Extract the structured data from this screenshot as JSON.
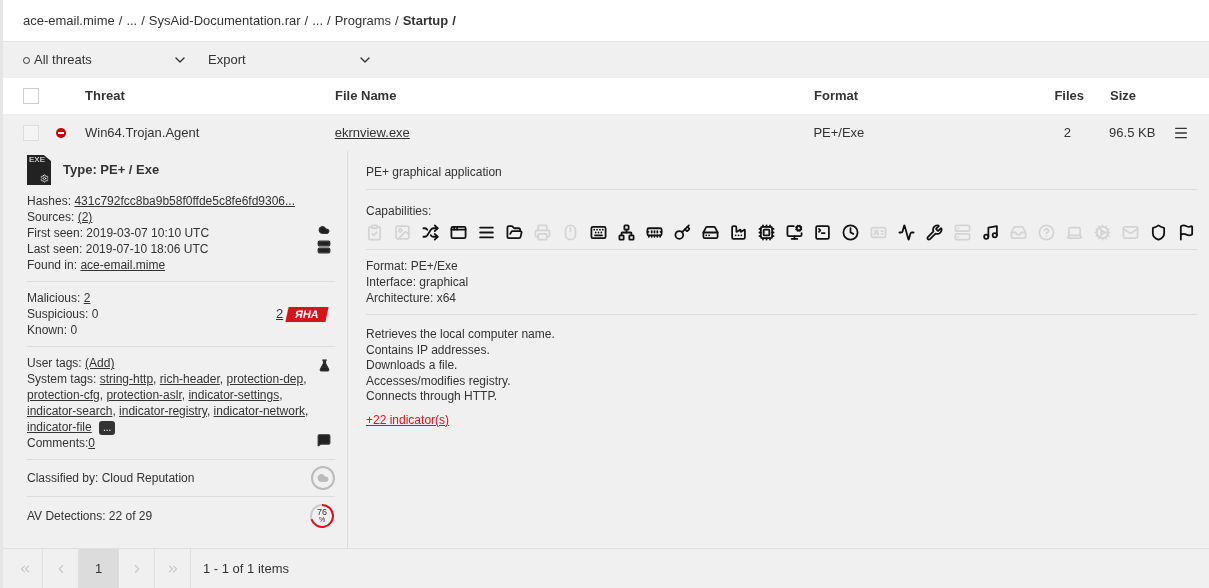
{
  "breadcrumb": {
    "separator": "/",
    "items": [
      {
        "label": "ace-email.mime",
        "current": false
      },
      {
        "label": "...",
        "current": false
      },
      {
        "label": "SysAid-Documentation.rar",
        "current": false
      },
      {
        "label": "...",
        "current": false
      },
      {
        "label": "Programs",
        "current": false
      },
      {
        "label": "Startup",
        "current": true
      }
    ]
  },
  "toolbar": {
    "filter": "All threats",
    "export": "Export"
  },
  "table": {
    "header_checked": false,
    "columns": [
      "Threat",
      "File Name",
      "Format",
      "Files",
      "Size"
    ],
    "rows": [
      {
        "checked": false,
        "expanded": true,
        "threat": "Win64.Trojan.Agent",
        "file_name": "ekrnview.exe",
        "format": "PE+/Exe",
        "files": "2",
        "size": "96.5 KB"
      }
    ]
  },
  "details": {
    "file_badge": "EXE",
    "type": "Type: PE+ / Exe",
    "info": [
      {
        "label": "Hashes:",
        "value": "431c792fcc8ba9b58f0ffde5c8fe6fd9306...",
        "link": true
      },
      {
        "label": "Sources:",
        "value": "(2)",
        "link": true
      },
      {
        "label": "First seen:",
        "value": "2019-03-07 10:10 UTC",
        "link": false
      },
      {
        "label": "Last seen:",
        "value": "2019-07-10 18:06 UTC",
        "link": false
      },
      {
        "label": "Found in:",
        "value": "ace-email.mime",
        "link": true
      }
    ],
    "counts": [
      {
        "label": "Malicious:",
        "value": "2",
        "link": true
      },
      {
        "label": "Suspicious:",
        "value": "0",
        "link": false
      },
      {
        "label": "Known:",
        "value": "0",
        "link": false
      }
    ],
    "rha": {
      "count": "2",
      "badge": "ЯHA"
    },
    "user_tags": {
      "label": "User tags:",
      "value": "(Add)"
    },
    "system_tags": {
      "label": "System tags:",
      "tags": [
        "string-http",
        "rich-header",
        "protection-dep",
        "protection-cfg",
        "protection-aslr",
        "indicator-settings",
        "indicator-search",
        "indicator-registry",
        "indicator-network",
        "indicator-file"
      ],
      "separator": ",",
      "more": "..."
    },
    "comments": {
      "label": "Comments:",
      "value": "0"
    },
    "classified": "Classified by: Cloud Reputation",
    "av": {
      "text": "AV Detections: 22 of 29",
      "percent": "76",
      "unit": "%"
    },
    "summary": "PE+ graphical application",
    "capabilities_label": "Capabilities:",
    "capabilities": [
      {
        "active": false
      },
      {
        "active": false
      },
      {
        "active": true
      },
      {
        "active": true
      },
      {
        "active": true
      },
      {
        "active": true
      },
      {
        "active": false
      },
      {
        "active": false
      },
      {
        "active": true
      },
      {
        "active": true
      },
      {
        "active": true
      },
      {
        "active": true
      },
      {
        "active": true
      },
      {
        "active": true
      },
      {
        "active": true
      },
      {
        "active": true
      },
      {
        "active": true
      },
      {
        "active": true
      },
      {
        "active": false
      },
      {
        "active": true
      },
      {
        "active": true
      },
      {
        "active": false
      },
      {
        "active": true
      },
      {
        "active": false
      },
      {
        "active": false
      },
      {
        "active": false
      },
      {
        "active": false
      },
      {
        "active": false
      },
      {
        "active": true
      },
      {
        "active": true
      }
    ],
    "properties": [
      "Format: PE+/Exe",
      "Interface: graphical",
      "Architecture: x64"
    ],
    "behaviors": [
      "Retrieves the local computer name.",
      "Contains IP addresses.",
      "Downloads a file.",
      "Accesses/modifies registry.",
      "Connects through HTTP."
    ],
    "more_indicators": "+22 indicator(s)"
  },
  "pager": {
    "nav_before": [
      {
        "kind": "first",
        "disabled": true
      },
      {
        "kind": "prev",
        "disabled": true
      }
    ],
    "pages": [
      {
        "label": "1",
        "selected": true
      }
    ],
    "nav_after": [
      {
        "kind": "next",
        "disabled": true
      },
      {
        "kind": "last",
        "disabled": true
      }
    ],
    "info": "1 - 1 of 1 items"
  }
}
